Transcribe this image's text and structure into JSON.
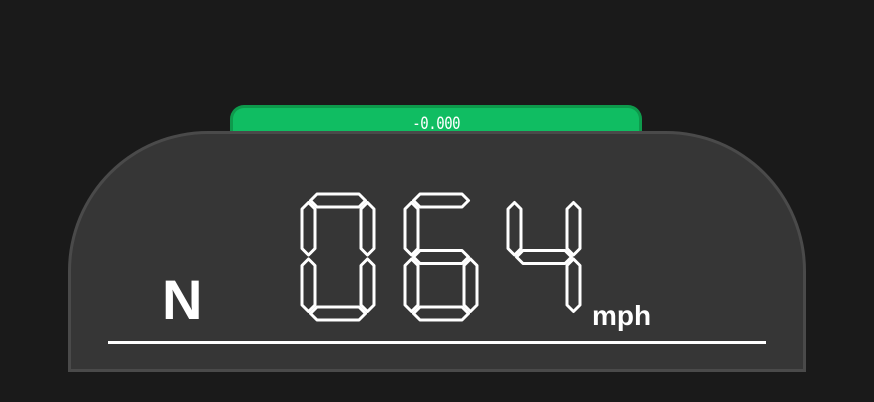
{
  "cluster": {
    "status_value": "-0.000",
    "gear": "N",
    "speed_digits": [
      "0",
      "6",
      "4"
    ],
    "unit": "mph"
  },
  "colors": {
    "background": "#1a1a1a",
    "panel": "#363636",
    "panel_border": "#4a4a4a",
    "status_tab": "#10bd62",
    "foreground": "#ffffff"
  }
}
